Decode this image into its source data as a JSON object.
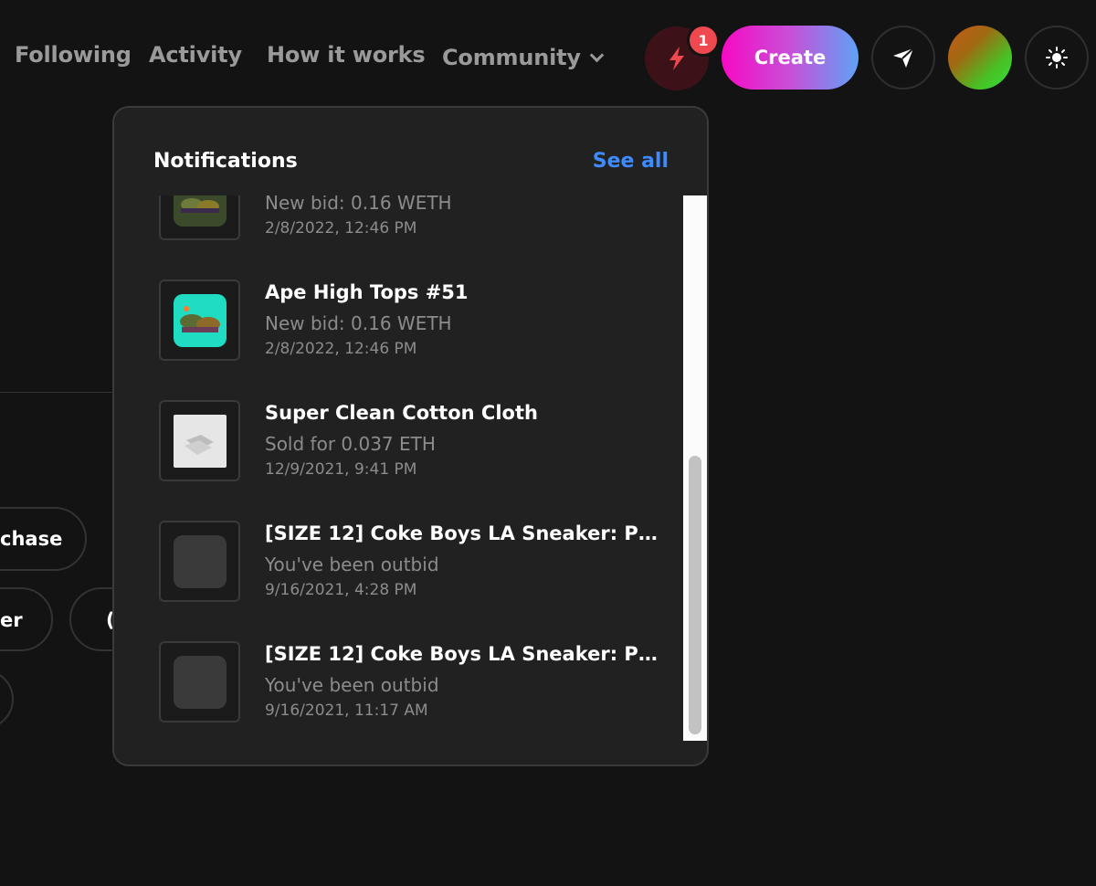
{
  "nav": {
    "following": "Following",
    "activity": "Activity",
    "how_it_works": "How it works",
    "community": "Community"
  },
  "header": {
    "notification_count": "1",
    "create_label": "Create",
    "accent_color": "#f709c4"
  },
  "background": {
    "pill_1": "chase",
    "pill_2": "er",
    "pill_3": "("
  },
  "notifications": {
    "title": "Notifications",
    "see_all": "See all",
    "items": [
      {
        "title": "",
        "subtitle": "New bid: 0.16 WETH",
        "date": "2/8/2022, 12:46 PM"
      },
      {
        "title": "Ape High Tops #51",
        "subtitle": "New bid: 0.16 WETH",
        "date": "2/8/2022, 12:46 PM"
      },
      {
        "title": "Super Clean Cotton Cloth",
        "subtitle": "Sold for 0.037 ETH",
        "date": "12/9/2021, 9:41 PM"
      },
      {
        "title": "[SIZE 12] Coke Boys LA Sneaker: Phy...",
        "subtitle": "You've been outbid",
        "date": "9/16/2021, 4:28 PM"
      },
      {
        "title": "[SIZE 12] Coke Boys LA Sneaker: Phy...",
        "subtitle": "You've been outbid",
        "date": "9/16/2021, 11:17 AM"
      }
    ]
  },
  "icons": {
    "notifications": "lightning-bolt-icon",
    "send": "send-icon",
    "theme": "sun-icon",
    "dropdown": "chevron-down-icon"
  }
}
